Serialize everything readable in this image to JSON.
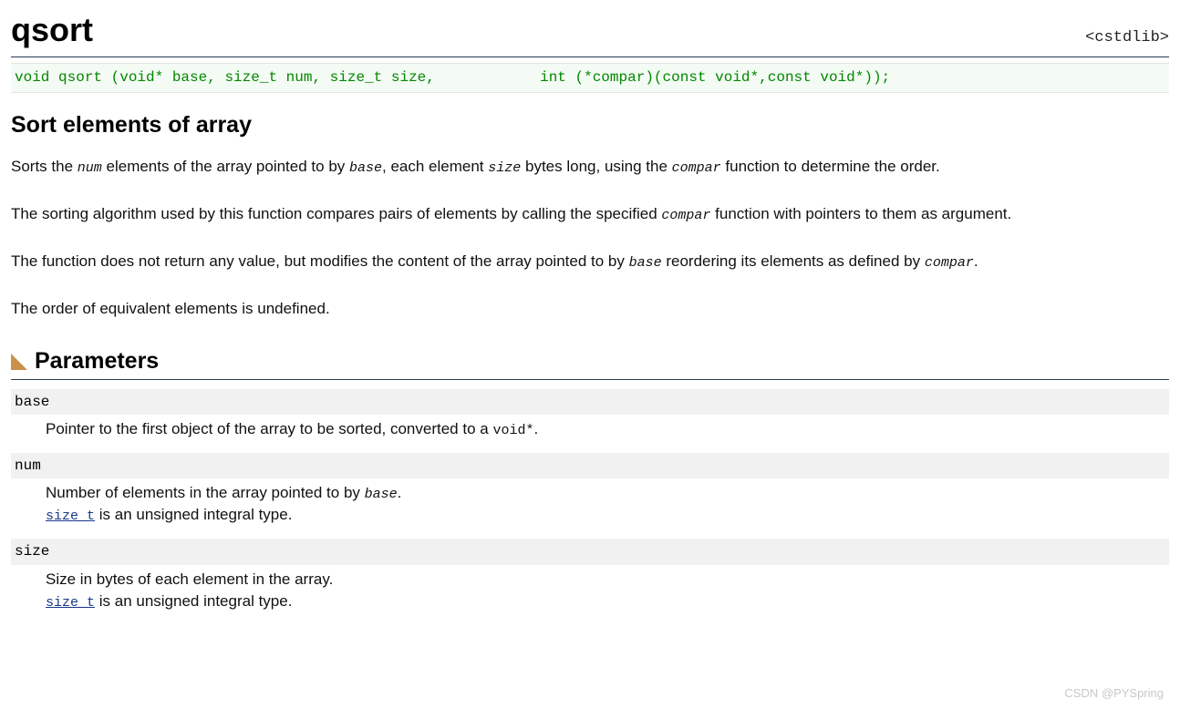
{
  "header": {
    "title": "qsort",
    "include": "<cstdlib>"
  },
  "signature": "void qsort (void* base, size_t num, size_t size,            int (*compar)(const void*,const void*));",
  "subtitle": "Sort elements of array",
  "desc": {
    "p1_a": "Sorts the ",
    "p1_num": "num",
    "p1_b": " elements of the array pointed to by ",
    "p1_base": "base",
    "p1_c": ", each element ",
    "p1_size": "size",
    "p1_d": " bytes long, using the ",
    "p1_compar": "compar",
    "p1_e": " function to determine the order.",
    "p2_a": "The sorting algorithm used by this function compares pairs of elements by calling the specified ",
    "p2_compar": "compar",
    "p2_b": " function with pointers to them as argument.",
    "p3_a": "The function does not return any value, but modifies the content of the array pointed to by ",
    "p3_base": "base",
    "p3_b": " reordering its elements as defined by ",
    "p3_compar": "compar",
    "p3_c": ".",
    "p4": "The order of equivalent elements is undefined."
  },
  "params_title": "Parameters",
  "params": {
    "base": {
      "term": "base",
      "def_a": "Pointer to the first object of the array to be sorted, converted to a ",
      "def_code": "void*",
      "def_b": "."
    },
    "num": {
      "term": "num",
      "def_a": "Number of elements in the array pointed to by ",
      "def_param": "base",
      "def_b": ".",
      "line2_link": "size_t",
      "line2_rest": " is an unsigned integral type."
    },
    "size": {
      "term": "size",
      "def_a": "Size in bytes of each element in the array.",
      "line2_link": "size_t",
      "line2_rest": " is an unsigned integral type."
    }
  },
  "watermark": "CSDN @PYSpring"
}
